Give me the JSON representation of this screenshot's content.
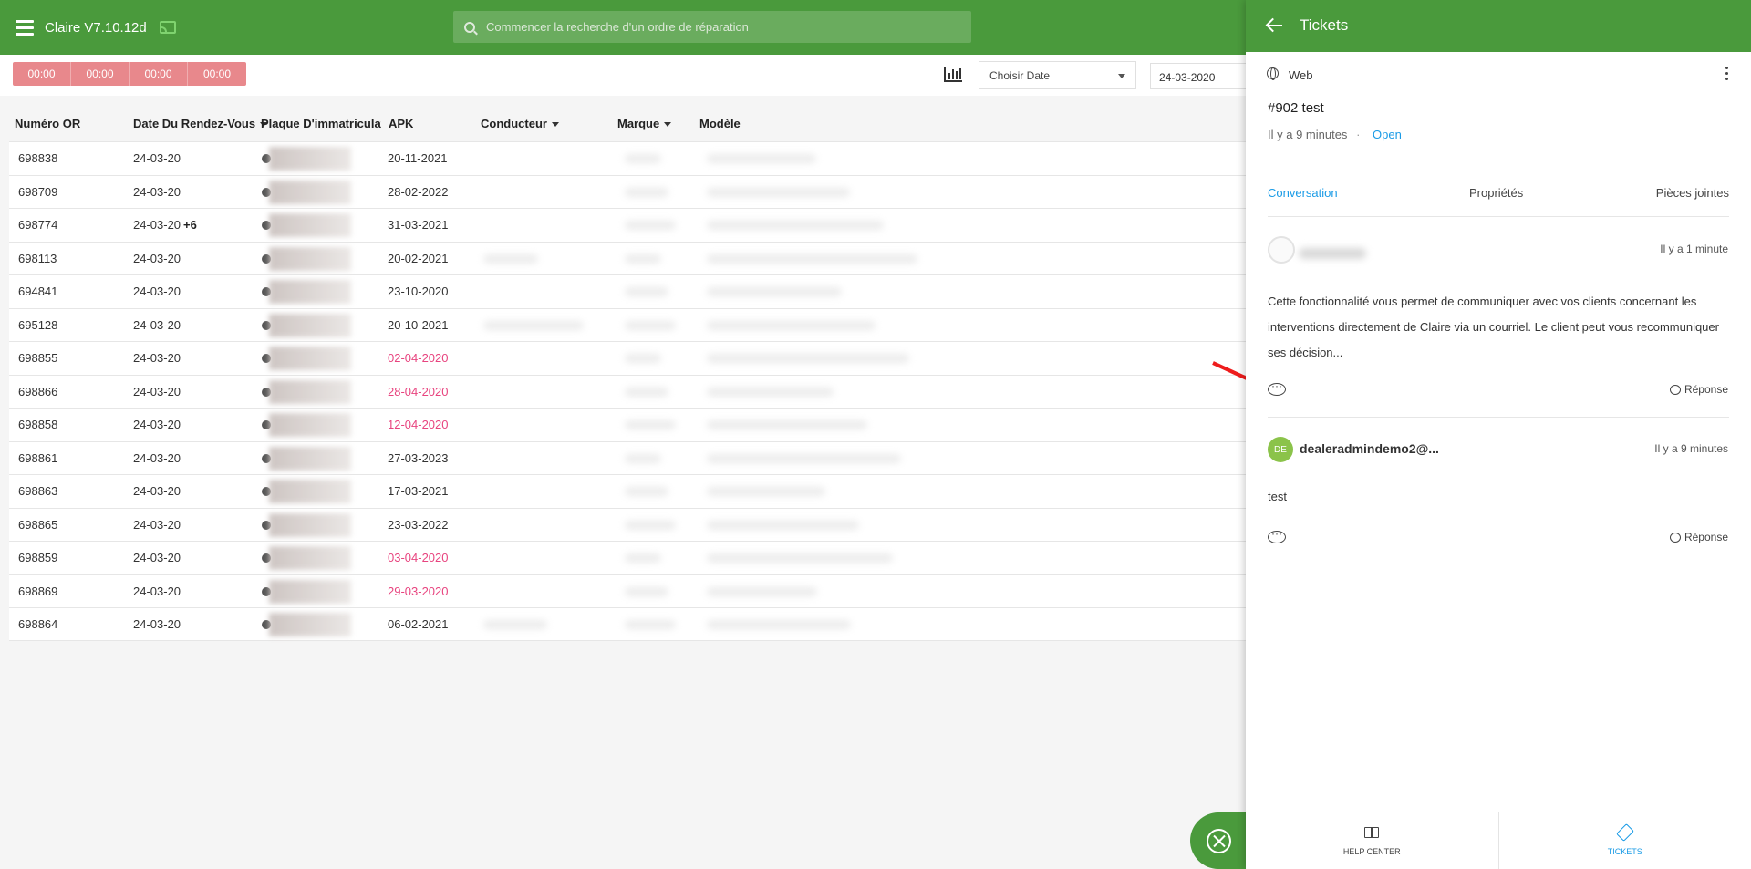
{
  "header": {
    "app_title": "Claire V7.10.12d",
    "search_placeholder": "Commencer la recherche d'un ordre de réparation"
  },
  "toolbar": {
    "timers": [
      "00:00",
      "00:00",
      "00:00",
      "00:00"
    ],
    "date_select": "Choisir Date",
    "date_value": "24-03-2020"
  },
  "table": {
    "headers": {
      "or": "Numéro OR",
      "date": "Date Du Rendez-Vous",
      "plate": "Plaque D'immatriculatio",
      "apk": "APK",
      "driver": "Conducteur",
      "brand": "Marque",
      "model": "Modèle"
    },
    "rows": [
      {
        "or": "698838",
        "date": "24-03-20",
        "extra": "",
        "apk": "20-11-2021",
        "apk_status": "normal"
      },
      {
        "or": "698709",
        "date": "24-03-20",
        "extra": "",
        "apk": "28-02-2022",
        "apk_status": "normal"
      },
      {
        "or": "698774",
        "date": "24-03-20",
        "extra": "+6",
        "apk": "31-03-2021",
        "apk_status": "normal"
      },
      {
        "or": "698113",
        "date": "24-03-20",
        "extra": "",
        "apk": "20-02-2021",
        "apk_status": "normal"
      },
      {
        "or": "694841",
        "date": "24-03-20",
        "extra": "",
        "apk": "23-10-2020",
        "apk_status": "normal"
      },
      {
        "or": "695128",
        "date": "24-03-20",
        "extra": "",
        "apk": "20-10-2021",
        "apk_status": "normal"
      },
      {
        "or": "698855",
        "date": "24-03-20",
        "extra": "",
        "apk": "02-04-2020",
        "apk_status": "due"
      },
      {
        "or": "698866",
        "date": "24-03-20",
        "extra": "",
        "apk": "28-04-2020",
        "apk_status": "due"
      },
      {
        "or": "698858",
        "date": "24-03-20",
        "extra": "",
        "apk": "12-04-2020",
        "apk_status": "due"
      },
      {
        "or": "698861",
        "date": "24-03-20",
        "extra": "",
        "apk": "27-03-2023",
        "apk_status": "normal"
      },
      {
        "or": "698863",
        "date": "24-03-20",
        "extra": "",
        "apk": "17-03-2021",
        "apk_status": "normal"
      },
      {
        "or": "698865",
        "date": "24-03-20",
        "extra": "",
        "apk": "23-03-2022",
        "apk_status": "normal"
      },
      {
        "or": "698859",
        "date": "24-03-20",
        "extra": "",
        "apk": "03-04-2020",
        "apk_status": "due"
      },
      {
        "or": "698869",
        "date": "24-03-20",
        "extra": "",
        "apk": "29-03-2020",
        "apk_status": "due"
      },
      {
        "or": "698864",
        "date": "24-03-20",
        "extra": "",
        "apk": "06-02-2021",
        "apk_status": "normal"
      }
    ]
  },
  "panel": {
    "title": "Tickets",
    "channel": "Web",
    "ticket_title": "#902 test",
    "ticket_time": "Il y a 9 minutes",
    "ticket_sep": "·",
    "ticket_status": "Open",
    "tabs": [
      "Conversation",
      "Propriétés",
      "Pièces jointes"
    ],
    "messages": [
      {
        "time": "Il y a 1 minute",
        "body": "Cette fonctionnalité vous permet de communiquer avec vos clients concernant les interventions directement de Claire via un courriel. Le client peut vous recommuniquer ses décision...",
        "reply": "Réponse"
      },
      {
        "avatar": "DE",
        "author": "dealeradmindemo2@...",
        "time": "Il y a 9 minutes",
        "body": "test",
        "reply": "Réponse"
      }
    ],
    "footer": {
      "help_center": "HELP CENTER",
      "tickets": "TICKETS"
    }
  },
  "colors": {
    "brand_green": "#4a9a3c",
    "link_blue": "#1a9be6",
    "apk_due": "#e8447f",
    "timer_red": "#e8888c"
  }
}
